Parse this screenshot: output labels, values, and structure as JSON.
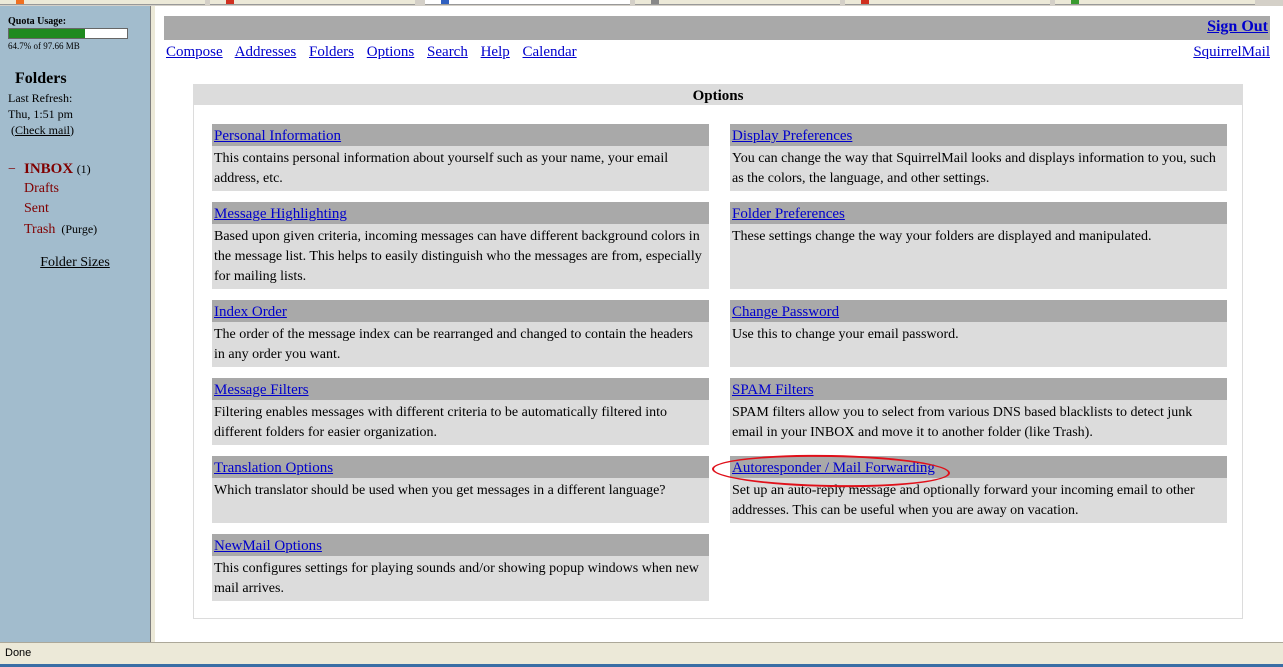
{
  "left": {
    "quota_label": "Quota Usage:",
    "quota_text": "64.7% of 97.66 MB",
    "quota_fraction": 0.647,
    "folders_title": "Folders",
    "last_refresh_label": "Last Refresh:",
    "last_refresh_time": "Thu, 1:51 pm",
    "check_mail_open": "(",
    "check_mail": "Check mail",
    "check_mail_close": ")",
    "folders": [
      {
        "prefix": "−",
        "name": "INBOX",
        "count": "(1)"
      },
      {
        "name": "Drafts"
      },
      {
        "name": "Sent"
      },
      {
        "name": "Trash",
        "purge": "(Purge)"
      }
    ],
    "folder_sizes": "Folder Sizes"
  },
  "header": {
    "sign_out": "Sign Out",
    "nav": [
      "Compose",
      "Addresses",
      "Folders",
      "Options",
      "Search",
      "Help",
      "Calendar"
    ],
    "brand_link": "SquirrelMail"
  },
  "options": {
    "title": "Options",
    "items": [
      {
        "title": "Personal Information",
        "desc": "This contains personal information about yourself such as your name, your email address, etc."
      },
      {
        "title": "Display Preferences",
        "desc": "You can change the way that SquirrelMail looks and displays information to you, such as the colors, the language, and other settings."
      },
      {
        "title": "Message Highlighting",
        "desc": "Based upon given criteria, incoming messages can have different background colors in the message list. This helps to easily distinguish who the messages are from, especially for mailing lists."
      },
      {
        "title": "Folder Preferences",
        "desc": "These settings change the way your folders are displayed and manipulated."
      },
      {
        "title": "Index Order",
        "desc": "The order of the message index can be rearranged and changed to contain the headers in any order you want."
      },
      {
        "title": "Change Password",
        "desc": "Use this to change your email password."
      },
      {
        "title": "Message Filters",
        "desc": "Filtering enables messages with different criteria to be automatically filtered into different folders for easier organization."
      },
      {
        "title": "SPAM Filters",
        "desc": "SPAM filters allow you to select from various DNS based blacklists to detect junk email in your INBOX and move it to another folder (like Trash)."
      },
      {
        "title": "Translation Options",
        "desc": "Which translator should be used when you get messages in a different language?"
      },
      {
        "title": "Autoresponder / Mail Forwarding",
        "desc": "Set up an auto-reply message and optionally forward your incoming email to other addresses. This can be useful when you are away on vacation."
      },
      {
        "title": "NewMail Options",
        "desc": "This configures settings for playing sounds and/or showing popup windows when new mail arrives."
      }
    ]
  },
  "status": {
    "text": "Done"
  },
  "colors": {
    "sidebar_bg": "#a2bccd",
    "header_bar": "#a9a9a9",
    "option_bg": "#dcdcdc",
    "folder_text": "#800000",
    "link": "#0000cc",
    "annotation": "#e0101a"
  }
}
